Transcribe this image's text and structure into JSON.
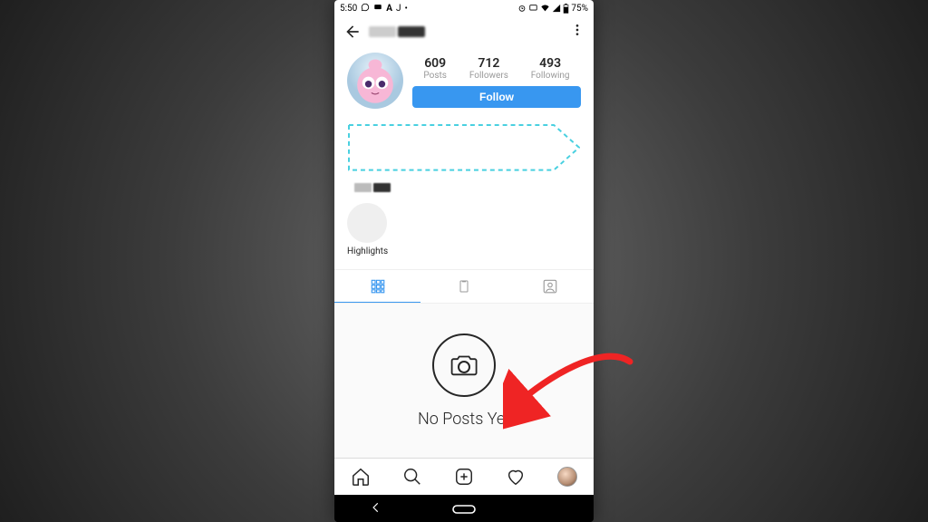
{
  "status": {
    "time": "5:50",
    "battery_text": "75%"
  },
  "header": {
    "username_redacted": true
  },
  "profile": {
    "stats": {
      "posts": {
        "value": "609",
        "label": "Posts"
      },
      "followers": {
        "value": "712",
        "label": "Followers"
      },
      "following": {
        "value": "493",
        "label": "Following"
      }
    },
    "follow_label": "Follow"
  },
  "highlights": {
    "label": "Highlights"
  },
  "empty_state": {
    "text": "No Posts Yet"
  },
  "colors": {
    "accent_blue": "#3897f0",
    "annotation_red": "#ef2424",
    "callout_teal": "#49d0e0"
  }
}
